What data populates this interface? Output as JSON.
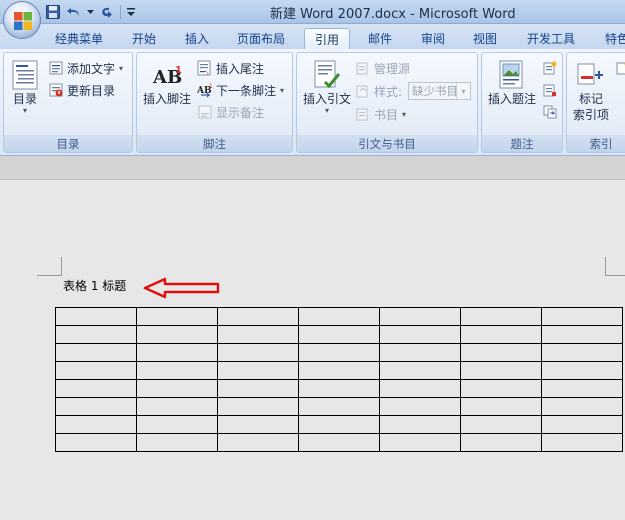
{
  "titlebar": {
    "title": "新建 Word 2007.docx - Microsoft Word"
  },
  "tabs": [
    "经典菜单",
    "开始",
    "插入",
    "页面布局",
    "引用",
    "邮件",
    "审阅",
    "视图",
    "开发工具",
    "特色"
  ],
  "active_tab": "引用",
  "groups": {
    "toc": {
      "label": "目录",
      "toc_button": "目录",
      "add_text": "添加文字",
      "update_toc": "更新目录"
    },
    "footnotes": {
      "label": "脚注",
      "insert_footnote": "插入脚注",
      "insert_endnote": "插入尾注",
      "next_footnote": "下一条脚注",
      "show_notes": "显示备注"
    },
    "citations": {
      "label": "引文与书目",
      "insert_citation": "插入引文",
      "manage_sources": "管理源",
      "style_label": "样式:",
      "style_value": "缺少书目",
      "bibliography": "书目"
    },
    "captions": {
      "label": "题注",
      "insert_caption": "插入题注"
    },
    "index": {
      "label": "索引",
      "mark_entry_line1": "标记",
      "mark_entry_line2": "索引项"
    }
  },
  "document": {
    "caption": "表格 1 标题",
    "table": {
      "rows": 8,
      "cols": 7
    }
  },
  "colors": {
    "arrow": "#e01010",
    "ribbon_text": "#15428b"
  }
}
